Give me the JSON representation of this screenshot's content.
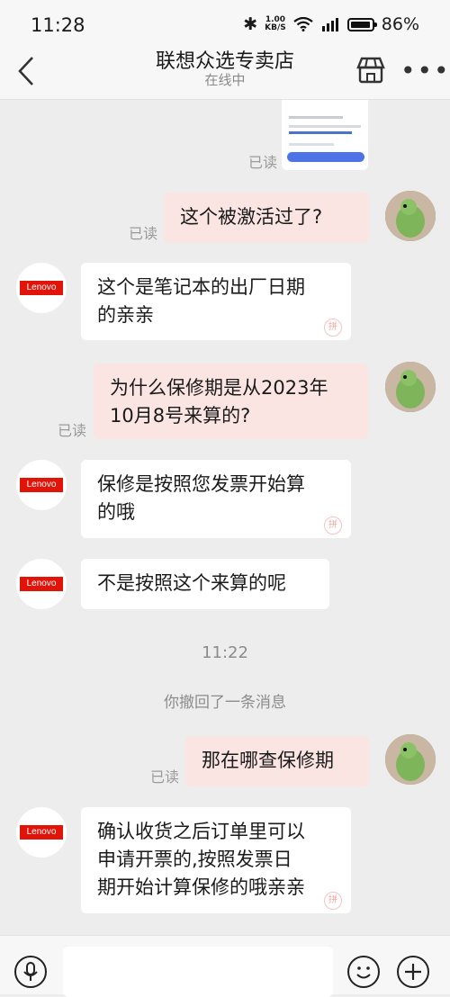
{
  "status": {
    "time": "11:28",
    "speed_top": "1.00",
    "speed_bottom": "KB/S",
    "battery": "86%"
  },
  "header": {
    "title": "联想众选专卖店",
    "subtitle": "在线中"
  },
  "labels": {
    "read": "已读"
  },
  "messages": [
    {
      "dir": "out",
      "text": "这个被激活过了?"
    },
    {
      "dir": "in",
      "line1": "这个是笔记本的出厂日期",
      "line2": "的亲亲"
    },
    {
      "dir": "out",
      "line1": "为什么保修期是从2023年",
      "line2": "10月8号来算的?"
    },
    {
      "dir": "in",
      "line1": "保修是按照您发票开始算",
      "line2": "的哦"
    },
    {
      "dir": "in",
      "text": "不是按照这个来算的呢"
    },
    {
      "dir": "out",
      "text": "那在哪查保修期"
    },
    {
      "dir": "in",
      "line1": "确认收货之后订单里可以",
      "line2": "申请开票的,按照发票日",
      "line3": "期开始计算保修的哦亲亲"
    }
  ],
  "timestamp": "11:22",
  "recall_notice": "你撤回了一条消息",
  "avatar_logo": "Lenovo",
  "watermark": "拼"
}
